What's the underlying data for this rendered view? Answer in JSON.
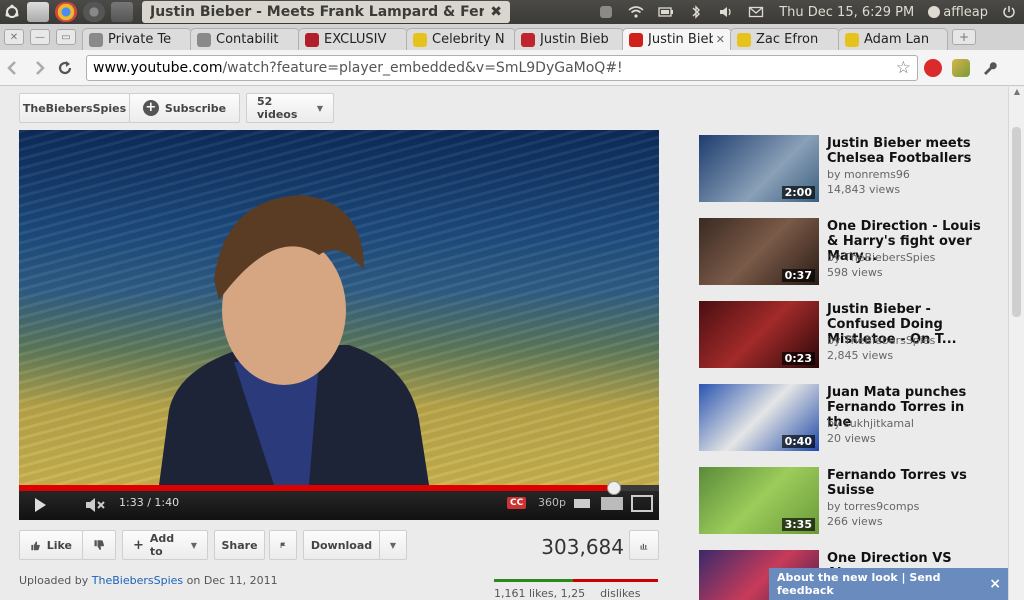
{
  "os_panel": {
    "window_title": "Justin Bieber - Meets Frank Lampard & Fer...",
    "clock": "Thu Dec 15,  6:29 PM",
    "user": "affleap"
  },
  "tabs": [
    {
      "label": "Private Te",
      "favicon_color": "#8a8a8a",
      "active": false
    },
    {
      "label": "Contabilit",
      "favicon_color": "#8a8a8a",
      "active": false
    },
    {
      "label": "EXCLUSIV",
      "favicon_color": "#b01e2a",
      "active": false
    },
    {
      "label": "Celebrity N",
      "favicon_color": "#e6c21c",
      "active": false
    },
    {
      "label": "Justin Bieb",
      "favicon_color": "#c0242d",
      "active": false
    },
    {
      "label": "Justin Bieb",
      "favicon_color": "#d0201c",
      "active": true
    },
    {
      "label": "Zac Efron",
      "favicon_color": "#e6c21c",
      "active": false
    },
    {
      "label": "Adam Lan",
      "favicon_color": "#e6c21c",
      "active": false
    }
  ],
  "address_bar": {
    "host": "www.youtube.com",
    "path": "/watch?feature=player_embedded&v=SmL9DyGaMoQ#!"
  },
  "channel_bar": {
    "channel": "TheBiebersSpies",
    "subscribe": "Subscribe",
    "videos": "52 videos"
  },
  "player": {
    "time": "1:33 / 1:40",
    "progress": 0.93,
    "cc": "CC",
    "quality": "360p"
  },
  "actions": {
    "like": "Like",
    "add_to": "Add to",
    "share": "Share",
    "download": "Download",
    "view_count": "303,684"
  },
  "upload": {
    "prefix": "Uploaded by",
    "channel": "TheBiebersSpies",
    "date": "on Dec 11, 2011",
    "likes_text": "1,161 likes, 1,25",
    "dislikes_text": "dislikes",
    "like_ratio": 0.48
  },
  "related": [
    {
      "title": "Justin Bieber meets Chelsea Footballers",
      "by": "by monrems96",
      "views": "14,843 views",
      "duration": "2:00"
    },
    {
      "title": "One Direction - Louis & Harry's fight over Mary...",
      "by": "by TheBiebersSpies",
      "views": "598 views",
      "duration": "0:37"
    },
    {
      "title": "Justin Bieber - Confused Doing Mistletoe - On T...",
      "by": "by TheBiebersSpies",
      "views": "2,845 views",
      "duration": "0:23"
    },
    {
      "title": "Juan Mata punches Fernando Torres in the",
      "by": "by sukhjitkamal",
      "views": "20 views",
      "duration": "0:40"
    },
    {
      "title": "Fernando Torres vs Suisse",
      "by": "by torres9comps",
      "views": "266 views",
      "duration": "3:35"
    },
    {
      "title": "One Direction VS Alan",
      "by": "",
      "views": "",
      "duration": ""
    }
  ],
  "feedback": {
    "text": "About the new look | Send feedback",
    "close": "×"
  }
}
